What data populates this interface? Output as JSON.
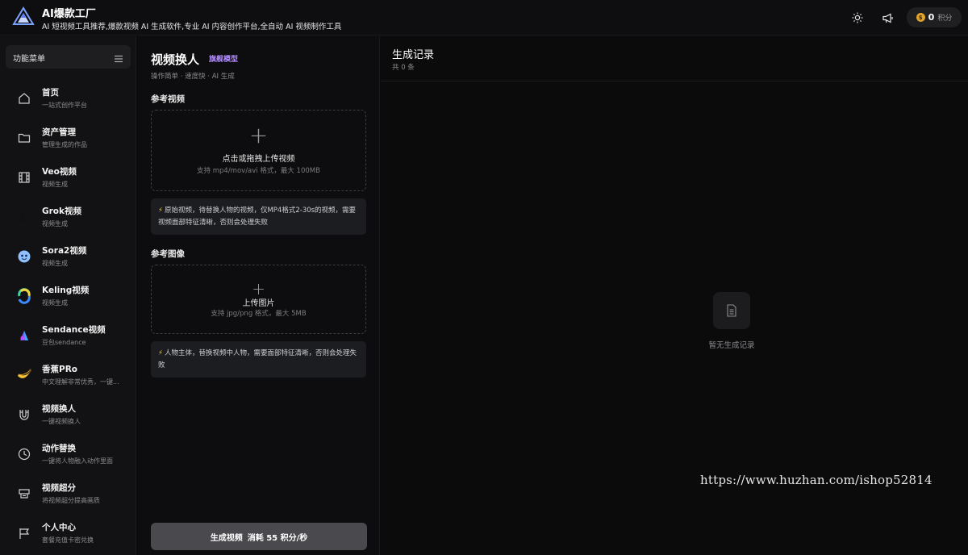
{
  "app": {
    "title": "AI爆款工厂",
    "logo_text": "AI爆款工厂",
    "subtitle": "AI 短视频工具推荐,爆款视频 AI 生成软件,专业 AI 内容创作平台,全自动 AI 视频制作工具"
  },
  "topbar": {
    "theme_icon": "sun-icon",
    "announce_icon": "megaphone-icon",
    "points_value": "0",
    "points_unit": "积分",
    "coin_icon": "coin-icon",
    "coin_symbol": "$"
  },
  "sidebar": {
    "header_title": "功能菜单",
    "items": [
      {
        "label": "首页",
        "desc": "一站式创作平台",
        "icon": "home-icon"
      },
      {
        "label": "资产管理",
        "desc": "管理生成的作品",
        "icon": "folder-icon"
      },
      {
        "label": "Veo视频",
        "desc": "视频生成",
        "icon": "film-icon"
      },
      {
        "label": "Grok视频",
        "desc": "视频生成",
        "icon": "grok-logo-icon"
      },
      {
        "label": "Sora2视频",
        "desc": "视频生成",
        "icon": "sora-logo-icon"
      },
      {
        "label": "Keling视频",
        "desc": "视频生成",
        "icon": "kling-logo-icon"
      },
      {
        "label": "Sendance视频",
        "desc": "豆包sendance",
        "icon": "sendance-logo-icon"
      },
      {
        "label": "香蕉PRo",
        "desc": "中文理解非常优秀，一键...",
        "icon": "banana-icon"
      },
      {
        "label": "视频换人",
        "desc": "一键视频换人",
        "icon": "magnet-icon"
      },
      {
        "label": "动作替换",
        "desc": "一键将人物融入动作里面",
        "icon": "clock-icon"
      },
      {
        "label": "视频超分",
        "desc": "将视频超分提高画质",
        "icon": "upscale-icon"
      },
      {
        "label": "个人中心",
        "desc": "套餐充值卡密兑换",
        "icon": "flag-icon"
      }
    ]
  },
  "main": {
    "title": "视频换人",
    "badge": "旗舰模型",
    "subtitle": "操作简单 · 速度快 · AI 生成",
    "video_section": {
      "title": "参考视频",
      "upload_label": "点击或拖拽上传视频",
      "upload_hint": "支持 mp4/mov/avi 格式，最大 100MB",
      "note": "原始视频，待替换人物的视频，仅MP4格式2-30s的视频，需要视频面部特征清晰，否则会处理失败"
    },
    "image_section": {
      "title": "参考图像",
      "upload_label": "上传图片",
      "upload_hint": "支持 jpg/png 格式，最大 5MB",
      "note": "人物主体，替换视频中人物，需要面部特征清晰，否则会处理失败"
    },
    "generate_button": {
      "label": "生成视频",
      "cost": "消耗 55 积分/秒"
    }
  },
  "records": {
    "title": "生成记录",
    "count": "共 0 条",
    "empty_text": "暂无生成记录",
    "empty_icon": "document-icon"
  },
  "watermark": "https://www.huzhan.com/ishop52814"
}
